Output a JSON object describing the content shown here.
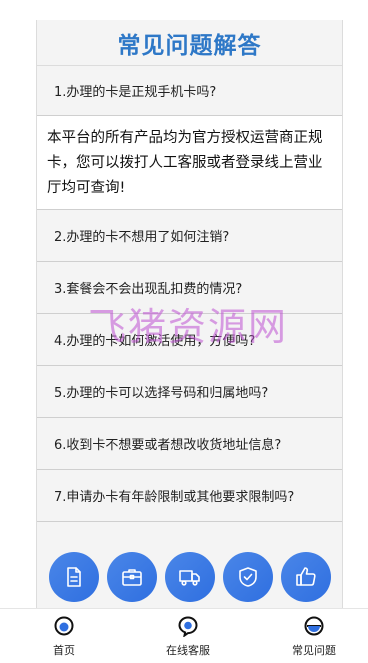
{
  "page": {
    "title": "常见问题解答",
    "watermark": "飞猪资源网"
  },
  "faq": [
    {
      "question": "1.办理的卡是正规手机卡吗?",
      "answer": "本平台的所有产品均为官方授权运营商正规卡，您可以拨打人工客服或者登录线上营业厅均可查询!",
      "expanded": true
    },
    {
      "question": "2.办理的卡不想用了如何注销?"
    },
    {
      "question": "3.套餐会不会出现乱扣费的情况?"
    },
    {
      "question": "4.办理的卡如何激活使用，方便吗?"
    },
    {
      "question": "5.办理的卡可以选择号码和归属地吗?"
    },
    {
      "question": "6.收到卡不想要或者想改收货地址信息?"
    },
    {
      "question": "7.申请办卡有年龄限制或其他要求限制吗?"
    }
  ],
  "shortcuts": [
    {
      "icon": "document-icon"
    },
    {
      "icon": "briefcase-icon"
    },
    {
      "icon": "truck-icon"
    },
    {
      "icon": "shield-check-icon"
    },
    {
      "icon": "thumbs-up-icon"
    }
  ],
  "tabbar": [
    {
      "label": "首页",
      "icon": "home-icon"
    },
    {
      "label": "在线客服",
      "icon": "chat-icon"
    },
    {
      "label": "常见问题",
      "icon": "faq-icon"
    }
  ],
  "colors": {
    "accent": "#2e78c7",
    "circle": "#3b7be4",
    "watermark": "#be50d2"
  }
}
